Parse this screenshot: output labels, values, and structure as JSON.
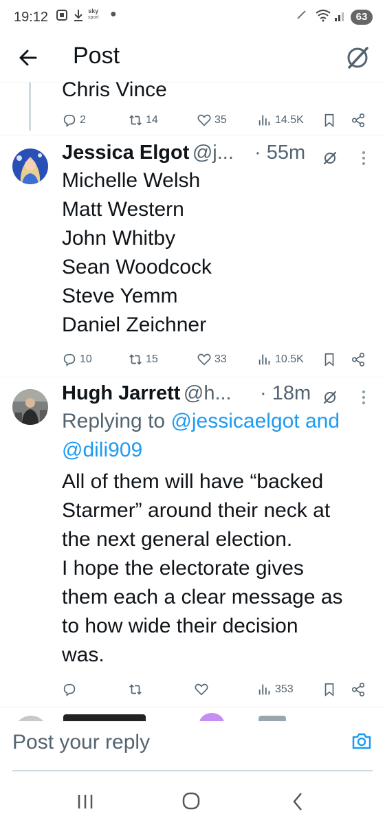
{
  "status_bar": {
    "time": "19:12",
    "sky_line1": "sky",
    "sky_line2": "sport",
    "battery": "63"
  },
  "header": {
    "title": "Post"
  },
  "tweet_prev": {
    "text_tail": "Chris Vince",
    "actions": {
      "replies": "2",
      "reposts": "14",
      "likes": "35",
      "views": "14.5K"
    }
  },
  "tweet_1": {
    "name": "Jessica Elgot",
    "handle": "@j...",
    "time": "· 55m",
    "lines": [
      "Michelle Welsh",
      "Matt Western",
      "John Whitby",
      "Sean Woodcock",
      "Steve Yemm",
      "Daniel Zeichner"
    ],
    "actions": {
      "replies": "10",
      "reposts": "15",
      "likes": "33",
      "views": "10.5K"
    }
  },
  "tweet_2": {
    "name": "Hugh Jarrett",
    "handle": "@h...",
    "time": "· 18m",
    "replying_prefix": "Replying to ",
    "replying_to": "@jessicaelgot and",
    "replying_to_2": "@dili909",
    "lines": [
      "All of them will have “backed",
      "Starmer” around their neck at",
      "the next general election.",
      "I hope the electorate gives",
      "them each a clear message as",
      "to how wide their decision",
      "was."
    ],
    "actions": {
      "views": "353"
    }
  },
  "reply": {
    "placeholder": "Post your reply"
  },
  "colors": {
    "accent": "#1d9bf0",
    "text": "#0f1419",
    "secondary": "#536471"
  }
}
